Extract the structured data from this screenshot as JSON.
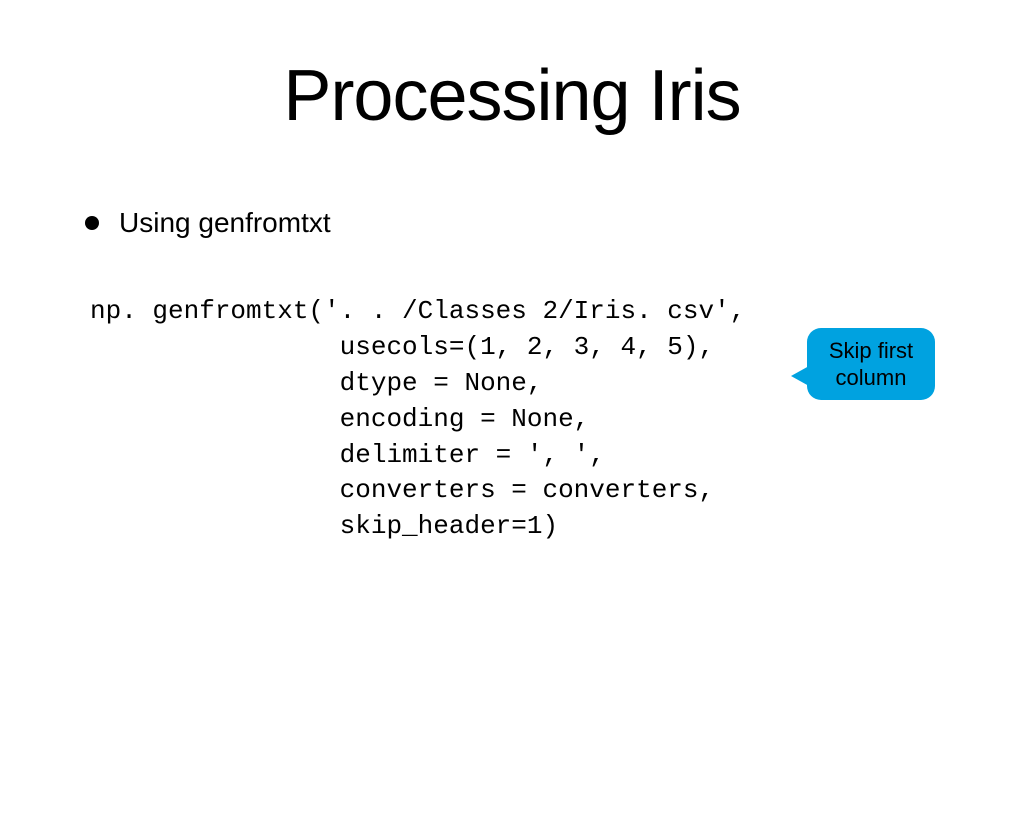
{
  "title": "Processing Iris",
  "bullet": "Using genfromtxt",
  "code": "np. genfromtxt('. . /Classes 2/Iris. csv',\n                usecols=(1, 2, 3, 4, 5),\n                dtype = None,\n                encoding = None,\n                delimiter = ', ',\n                converters = converters,\n                skip_header=1)",
  "callout": {
    "line1": "Skip first",
    "line2": "column"
  },
  "colors": {
    "callout_bg": "#00a2e0"
  }
}
